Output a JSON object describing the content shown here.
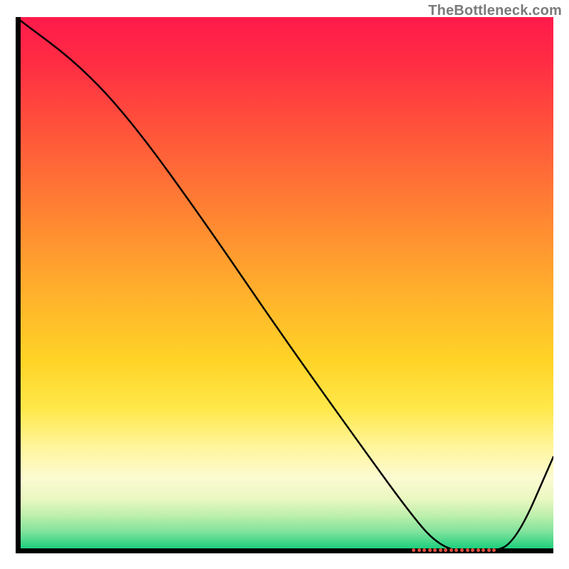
{
  "watermark_text": "TheBottleneck.com",
  "colors": {
    "axis": "#000000",
    "curve": "#000000",
    "marker": "#e64b3c",
    "gradient_top": "#ff1a4b",
    "gradient_bottom": "#0ac873"
  },
  "chart_data": {
    "type": "line",
    "title": "",
    "xlabel": "",
    "ylabel": "",
    "xlim": [
      0,
      100
    ],
    "ylim": [
      0,
      100
    ],
    "grid": false,
    "legend": false,
    "series": [
      {
        "name": "bottleneck_curve",
        "x": [
          0,
          12,
          22,
          35,
          50,
          65,
          73,
          78,
          83,
          88,
          93,
          100
        ],
        "values": [
          100,
          91,
          80,
          62,
          40,
          19,
          8,
          2,
          0,
          0,
          2,
          18
        ],
        "comment": "y is percentage height from bottom; valley minimum spans x≈78..88 at y≈0"
      },
      {
        "name": "valley_marker",
        "x": [
          74,
          75,
          76,
          77,
          78,
          79,
          80,
          81,
          82,
          83,
          84,
          85,
          86,
          87,
          88,
          89
        ],
        "values": [
          0.6,
          0.6,
          0.6,
          0.6,
          0.6,
          0.6,
          0.6,
          0.6,
          0.6,
          0.6,
          0.6,
          0.6,
          0.6,
          0.6,
          0.6,
          0.6
        ],
        "comment": "row of dotted markers sitting at the valley floor"
      }
    ],
    "background_gradient_note": "vertical heat gradient mapping y=100→red through orange/yellow→y=0 green; lower y = better / less bottleneck"
  }
}
